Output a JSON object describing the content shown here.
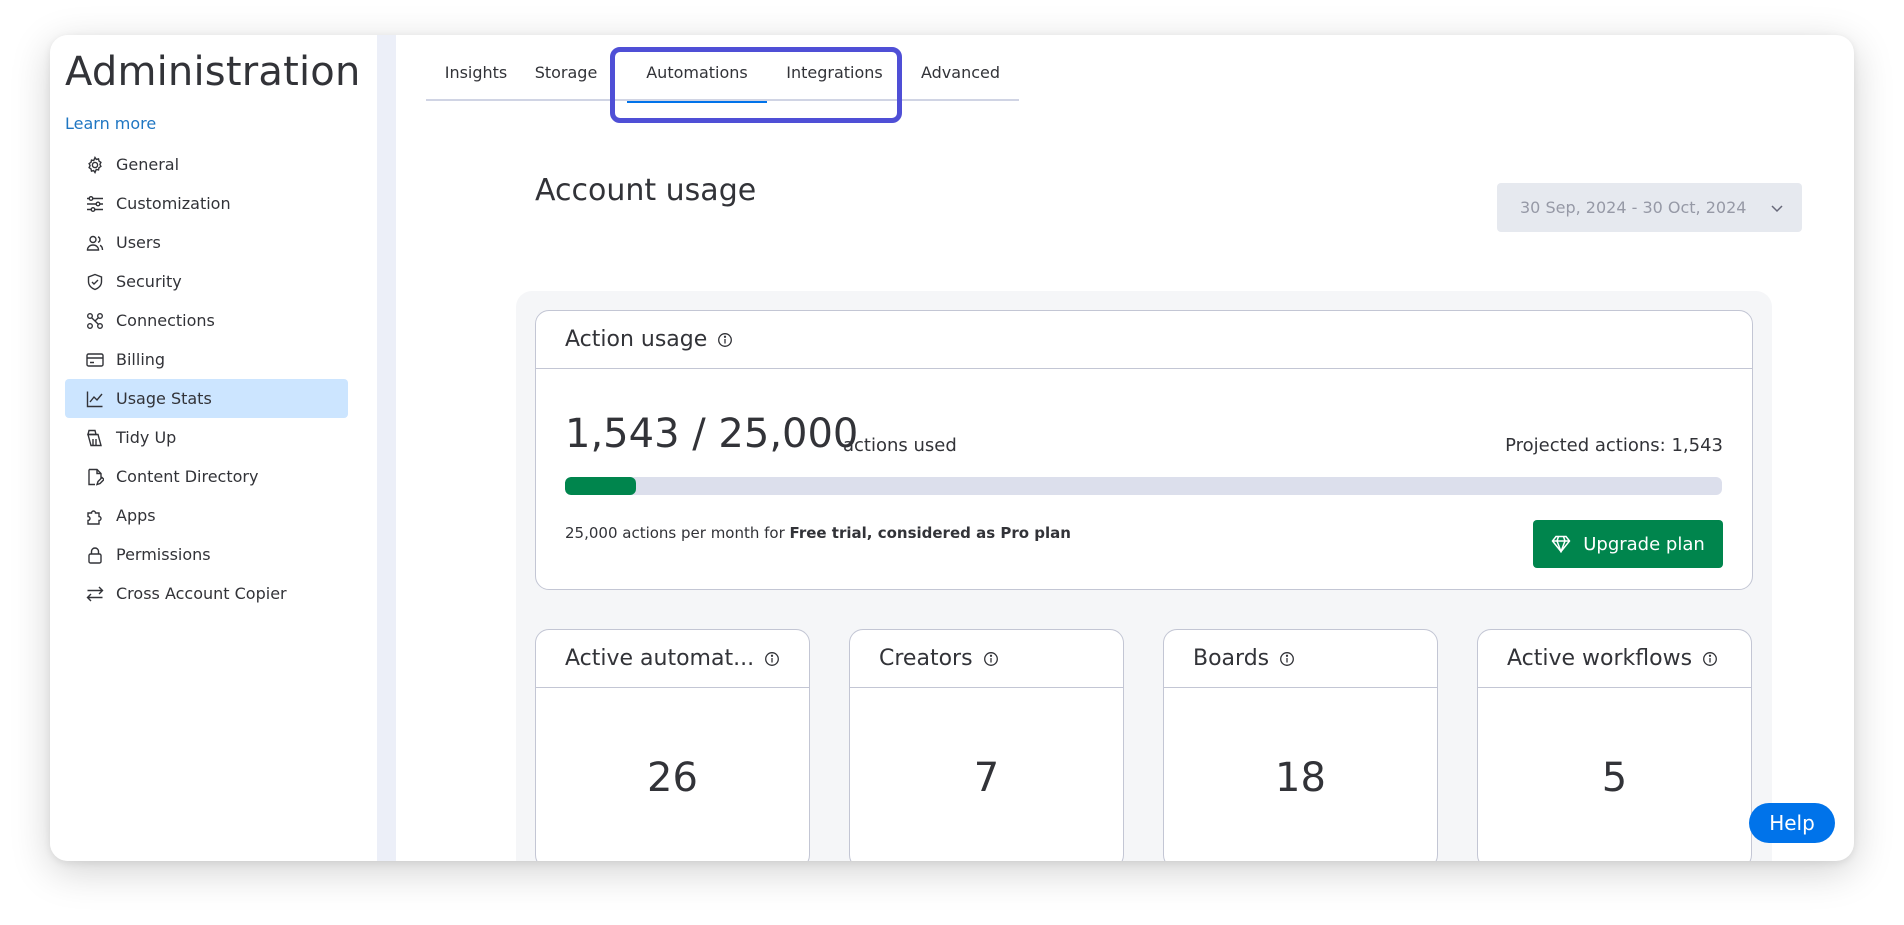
{
  "sidebar": {
    "title": "Administration",
    "learn_more": "Learn more",
    "items": [
      {
        "label": "General",
        "icon": "gear-icon"
      },
      {
        "label": "Customization",
        "icon": "sliders-icon"
      },
      {
        "label": "Users",
        "icon": "users-icon"
      },
      {
        "label": "Security",
        "icon": "shield-icon"
      },
      {
        "label": "Connections",
        "icon": "connections-icon"
      },
      {
        "label": "Billing",
        "icon": "credit-card-icon"
      },
      {
        "label": "Usage Stats",
        "icon": "line-chart-icon",
        "active": true
      },
      {
        "label": "Tidy Up",
        "icon": "broom-icon"
      },
      {
        "label": "Content Directory",
        "icon": "document-edit-icon"
      },
      {
        "label": "Apps",
        "icon": "puzzle-icon"
      },
      {
        "label": "Permissions",
        "icon": "lock-icon"
      },
      {
        "label": "Cross Account Copier",
        "icon": "arrows-swap-icon"
      }
    ]
  },
  "tabs": [
    {
      "label": "Insights"
    },
    {
      "label": "Storage"
    },
    {
      "label": "Automations",
      "selected": true
    },
    {
      "label": "Integrations"
    },
    {
      "label": "Advanced"
    }
  ],
  "page": {
    "title": "Account usage",
    "date_range": "30 Sep, 2024 - 30 Oct, 2024"
  },
  "action_usage": {
    "title": "Action usage",
    "value": "1,543 / 25,000",
    "unit": "actions used",
    "projected": "Projected actions: 1,543",
    "used": 1543,
    "limit": 25000,
    "plan_prefix": "25,000 actions per month for ",
    "plan_name": "Free trial, considered as Pro plan",
    "upgrade_label": "Upgrade plan"
  },
  "stats": [
    {
      "title": "Active automat...",
      "value": "26"
    },
    {
      "title": "Creators",
      "value": "7"
    },
    {
      "title": "Boards",
      "value": "18"
    },
    {
      "title": "Active workflows",
      "value": "5"
    }
  ],
  "help_label": "Help",
  "colors": {
    "accent": "#0073ea",
    "success": "#00854d",
    "highlight": "#4f4fd6",
    "active_nav": "#cce5ff"
  }
}
